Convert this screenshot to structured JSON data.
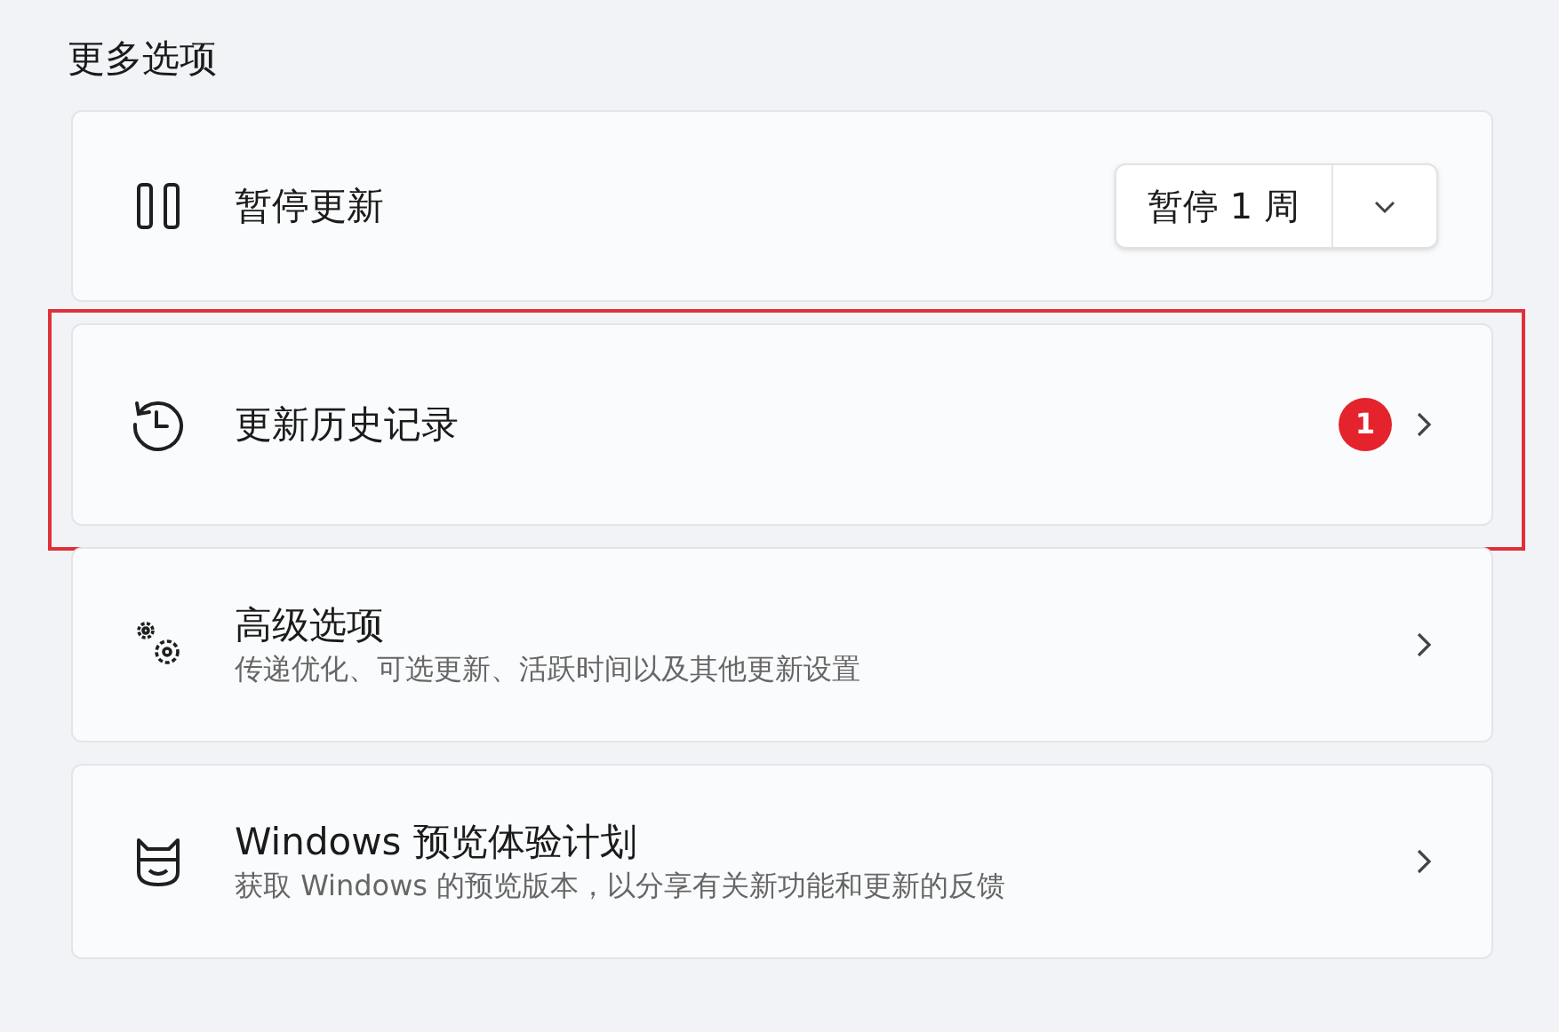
{
  "section_title": "更多选项",
  "items": [
    {
      "kind": "dropdown",
      "title": "暂停更新",
      "button": "暂停 1 周",
      "highlighted": false
    },
    {
      "kind": "link",
      "title": "更新历史记录",
      "badge": "1",
      "highlighted": true
    },
    {
      "kind": "link",
      "title": "高级选项",
      "subtitle": "传递优化、可选更新、活跃时间以及其他更新设置",
      "highlighted": false
    },
    {
      "kind": "link",
      "title": "Windows 预览体验计划",
      "subtitle": "获取 Windows 的预览版本，以分享有关新功能和更新的反馈",
      "highlighted": false
    }
  ]
}
